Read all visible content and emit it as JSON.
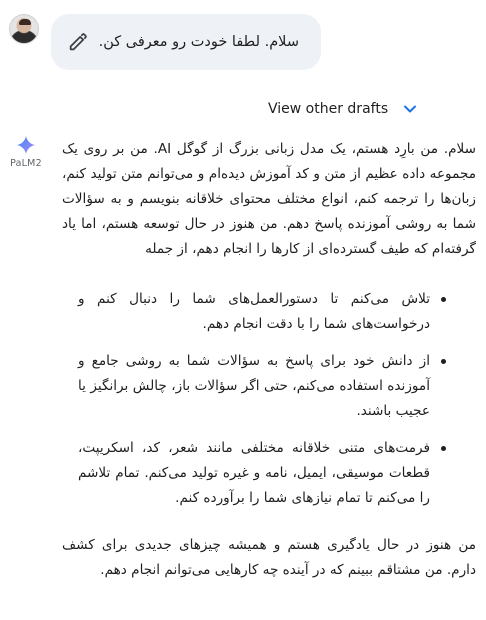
{
  "user_prompt": {
    "text": "سلام. لطفا خودت رو معرفی کن."
  },
  "drafts": {
    "label": "View other drafts"
  },
  "model": {
    "name": "PaLM2"
  },
  "response": {
    "intro": "سلام. من بارِد هستم، یک مدل زبانی بزرگ از گوگل AI. من بر روی یک مجموعه داده عظیم از متن و کد آموزش دیده‌ام و می‌توانم متن تولید کنم، زبان‌ها را ترجمه کنم، انواع مختلف محتوای خلاقانه بنویسم و به سؤالات شما به روشی آموزنده پاسخ دهم. من هنوز در حال توسعه هستم، اما یاد گرفته‌ام که طیف گسترده‌ای از کارها را انجام دهم، از جمله",
    "bullets": [
      "تلاش می‌کنم تا دستورالعمل‌های شما را دنبال کنم و درخواست‌های شما را با دقت انجام دهم.",
      "از دانش خود برای پاسخ به سؤالات شما به روشی جامع و آموزنده استفاده می‌کنم، حتی اگر سؤالات باز، چالش برانگیز یا عجیب باشند.",
      "فرمت‌های متنی خلاقانه مختلفی مانند شعر، کد، اسکریپت، قطعات موسیقی، ایمیل، نامه و غیره تولید می‌کنم. تمام تلاشم را می‌کنم تا تمام نیازهای شما را برآورده کنم."
    ],
    "closing": "من هنوز در حال یادگیری هستم و همیشه چیزهای جدیدی برای کشف دارم. من مشتاقم ببینم که در آینده چه کارهایی می‌توانم انجام دهم."
  },
  "colors": {
    "bubble": "#eef1f6",
    "accent": "#1a73e8",
    "text": "#1f1f1f"
  }
}
